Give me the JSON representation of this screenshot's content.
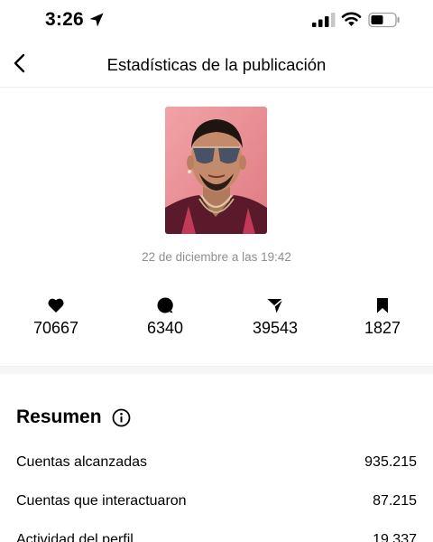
{
  "status_bar": {
    "time": "3:26",
    "icons": [
      "location-arrow-icon",
      "cellular-signal-icon",
      "wifi-icon",
      "battery-icon"
    ]
  },
  "header": {
    "title": "Estadísticas de la publicación",
    "back_icon": "chevron-left-icon"
  },
  "post": {
    "date": "22 de diciembre a las 19:42"
  },
  "stats": [
    {
      "icon": "heart-icon",
      "value": "70667"
    },
    {
      "icon": "comment-icon",
      "value": "6340"
    },
    {
      "icon": "share-icon",
      "value": "39543"
    },
    {
      "icon": "bookmark-icon",
      "value": "1827"
    }
  ],
  "summary": {
    "title": "Resumen",
    "rows": [
      {
        "label": "Cuentas alcanzadas",
        "value": "935.215"
      },
      {
        "label": "Cuentas que interactuaron",
        "value": "87.215"
      },
      {
        "label": "Actividad del perfil",
        "value": "19.337"
      }
    ]
  },
  "colors": {
    "text": "#000000",
    "muted": "#8e8e8e",
    "divider": "#f6f6f6",
    "thumbnail_bg": "#e98c92"
  }
}
